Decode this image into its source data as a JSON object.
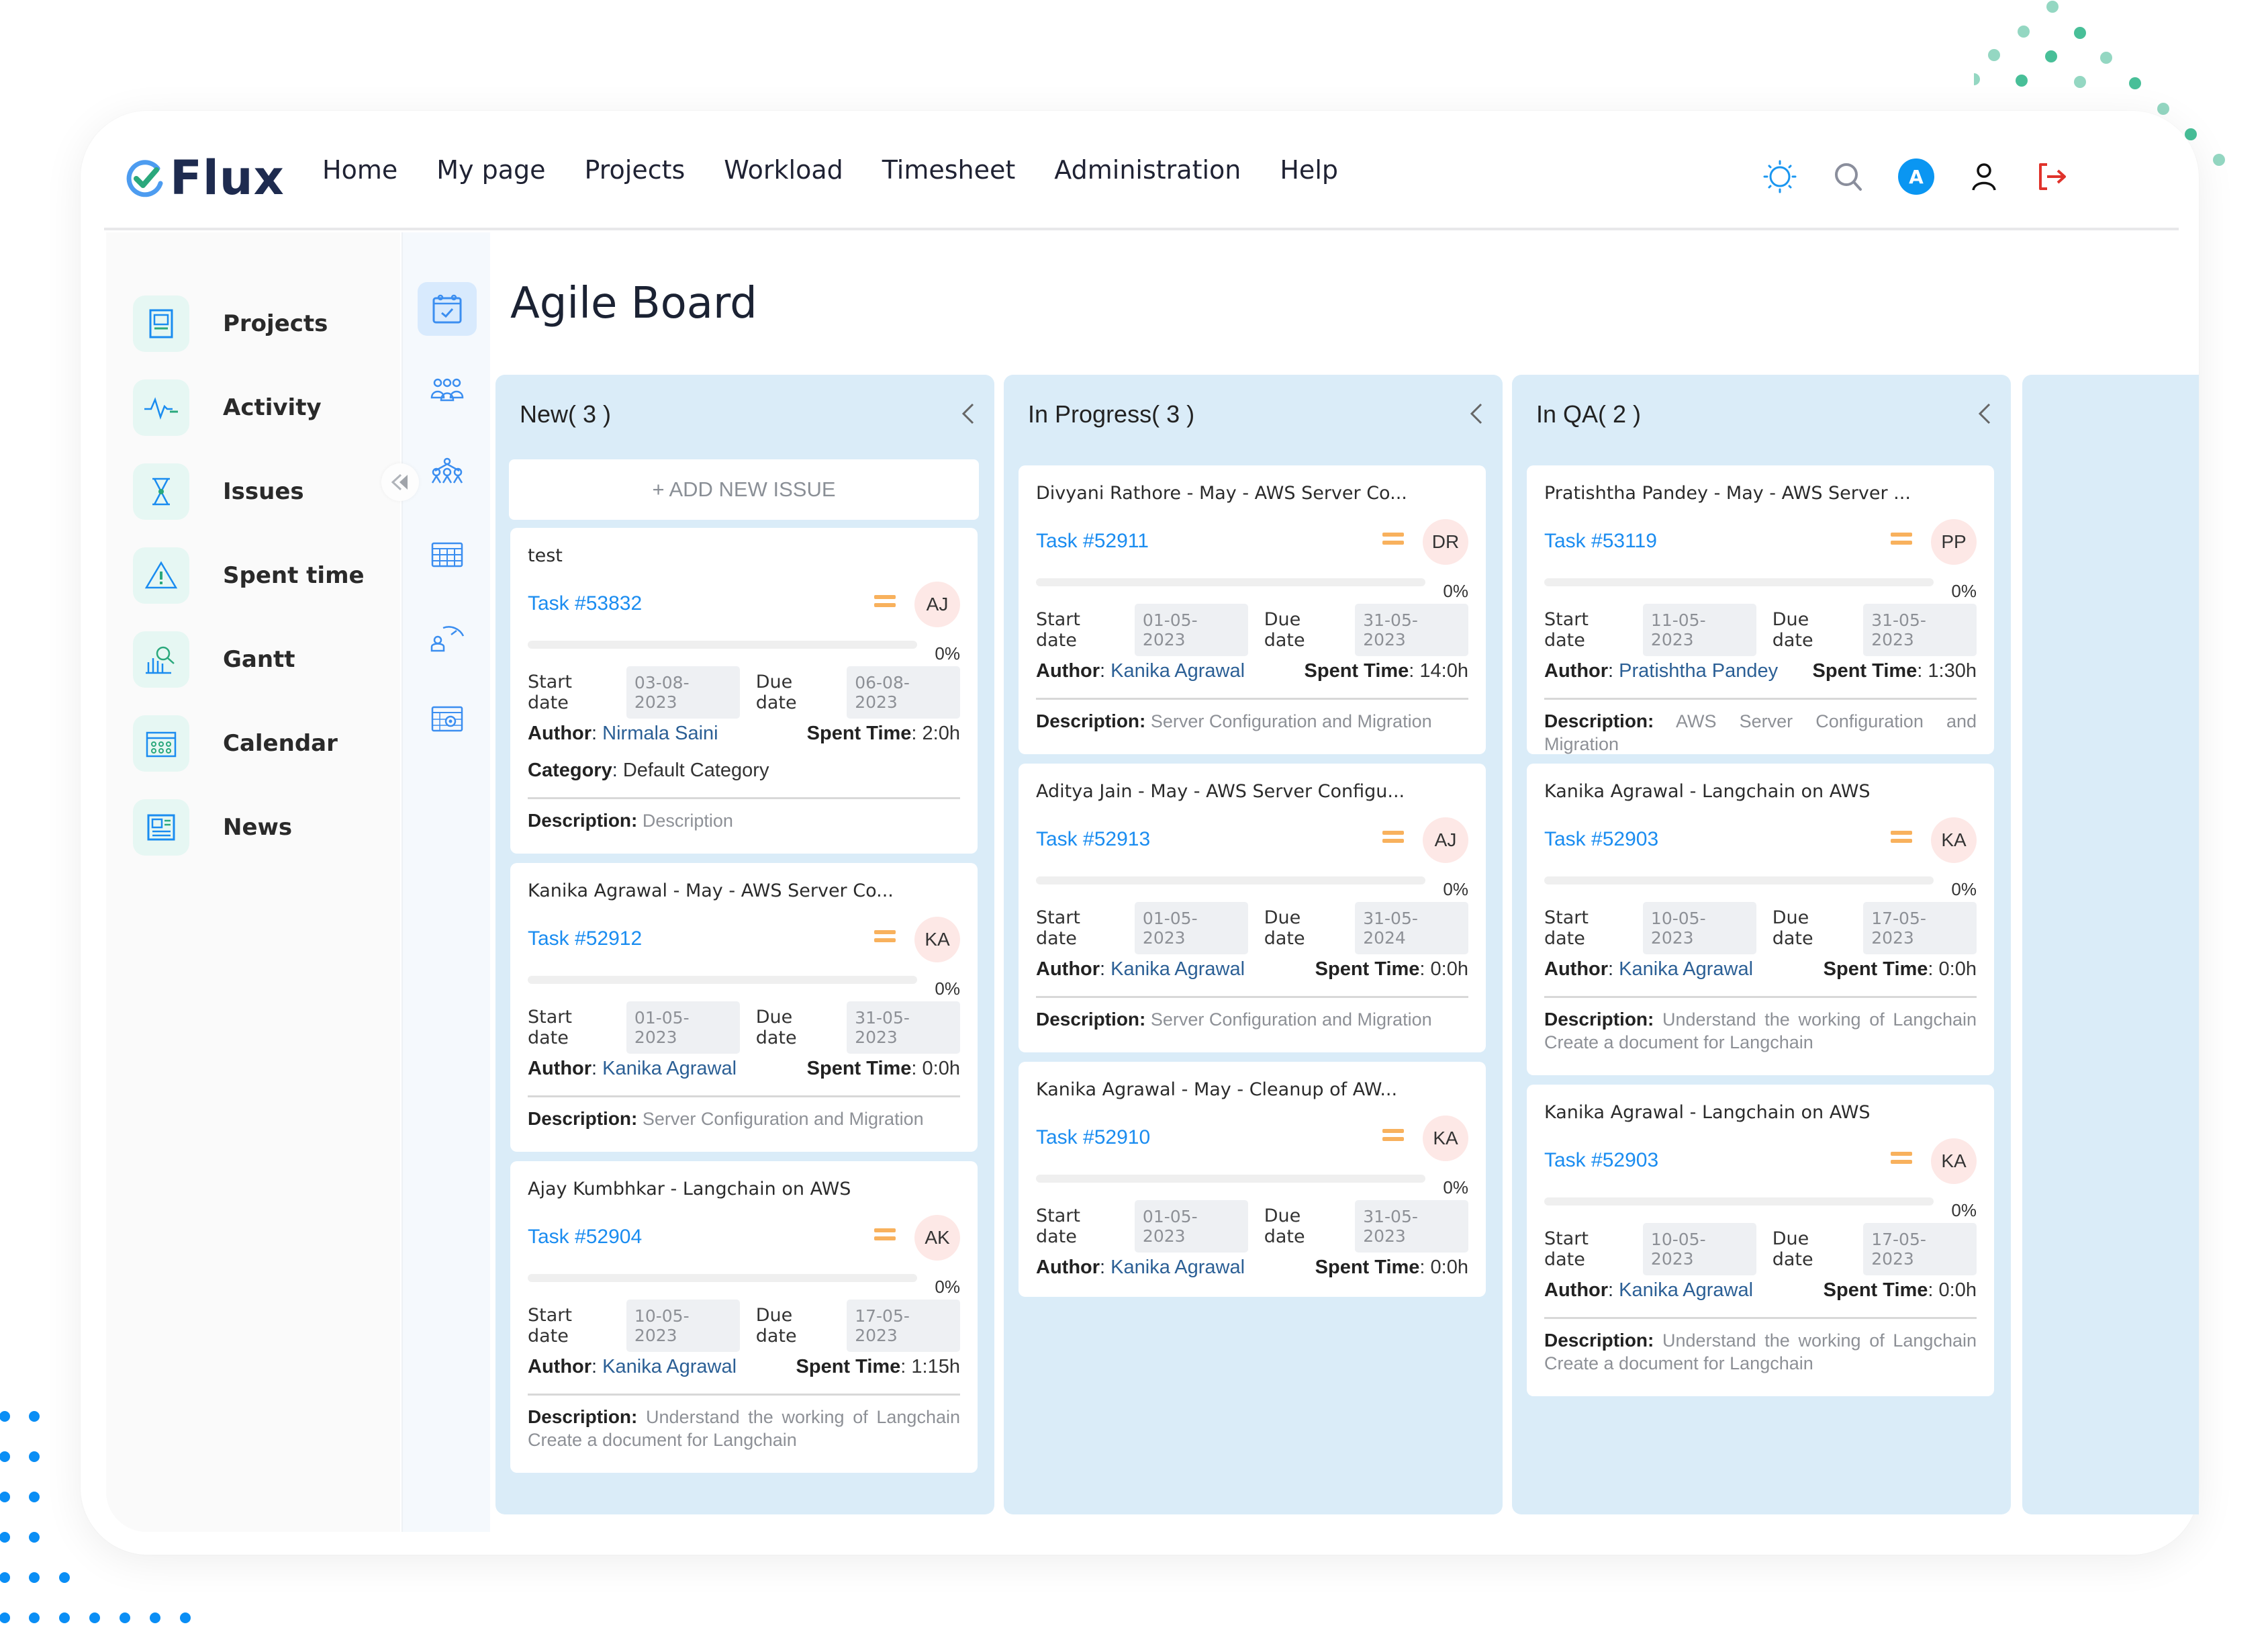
{
  "app": {
    "name": "Flux"
  },
  "nav": [
    "Home",
    "My page",
    "Projects",
    "Workload",
    "Timesheet",
    "Administration",
    "Help"
  ],
  "header_icons": {
    "theme": "sun-icon",
    "search": "search-icon",
    "avatar_initial": "A",
    "profile": "user-icon",
    "logout": "logout-icon"
  },
  "sidebar": {
    "items": [
      {
        "label": "Projects",
        "icon": "project-board-icon"
      },
      {
        "label": "Activity",
        "icon": "activity-pulse-icon"
      },
      {
        "label": "Issues",
        "icon": "hourglass-icon"
      },
      {
        "label": "Spent time",
        "icon": "warning-triangle-icon"
      },
      {
        "label": "Gantt",
        "icon": "gantt-chart-icon"
      },
      {
        "label": "Calendar",
        "icon": "calendar-icon"
      },
      {
        "label": "News",
        "icon": "news-icon"
      }
    ]
  },
  "rail": [
    "agile-board-icon",
    "team-icon",
    "network-icon",
    "table-icon",
    "performance-icon",
    "calendar-settings-icon"
  ],
  "page": {
    "title": "Agile Board"
  },
  "labels": {
    "add_issue": "+ ADD NEW ISSUE",
    "start_date": "Start date",
    "due_date": "Due date",
    "author": "Author",
    "spent_time": "Spent Time",
    "category": "Category",
    "description": "Description:"
  },
  "columns": [
    {
      "title": "New( 3 )",
      "cards": [
        {
          "title": "test",
          "task": "Task #53832",
          "assignee": "AJ",
          "progress": 0,
          "progress_label": "0%",
          "start": "03-08-2023",
          "due": "06-08-2023",
          "author": "Nirmala Saini",
          "spent": "2:0h",
          "category": "Default Category",
          "description": "Description"
        },
        {
          "title": "Kanika Agrawal - May - AWS Server Co...",
          "task": "Task #52912",
          "assignee": "KA",
          "progress": 0,
          "progress_label": "0%",
          "start": "01-05-2023",
          "due": "31-05-2023",
          "author": "Kanika Agrawal",
          "spent": "0:0h",
          "description": "Server Configuration and Migration"
        },
        {
          "title": "Ajay Kumbhkar - Langchain on AWS",
          "task": "Task #52904",
          "assignee": "AK",
          "progress": 0,
          "progress_label": "0%",
          "start": "10-05-2023",
          "due": "17-05-2023",
          "author": "Kanika Agrawal",
          "spent": "1:15h",
          "description": "Understand the working of Langchain Create a document for Langchain"
        }
      ]
    },
    {
      "title": "In Progress( 3 )",
      "cards": [
        {
          "title": "Divyani Rathore - May - AWS Server Co...",
          "task": "Task #52911",
          "assignee": "DR",
          "progress": 0,
          "progress_label": "0%",
          "start": "01-05-2023",
          "due": "31-05-2023",
          "author": "Kanika Agrawal",
          "spent": "14:0h",
          "description": "Server Configuration and Migration"
        },
        {
          "title": "Aditya Jain - May - AWS Server Configu...",
          "task": "Task #52913",
          "assignee": "AJ",
          "progress": 0,
          "progress_label": "0%",
          "start": "01-05-2023",
          "due": "31-05-2024",
          "author": "Kanika Agrawal",
          "spent": "0:0h",
          "description": "Server Configuration and Migration"
        },
        {
          "title": "Kanika Agrawal - May - Cleanup of AW...",
          "task": "Task #52910",
          "assignee": "KA",
          "progress": 0,
          "progress_label": "0%",
          "start": "01-05-2023",
          "due": "31-05-2023",
          "author": "Kanika Agrawal",
          "spent": "0:0h"
        }
      ]
    },
    {
      "title": "In QA( 2 )",
      "cards": [
        {
          "title": "Pratishtha Pandey - May - AWS Server ...",
          "task": "Task #53119",
          "assignee": "PP",
          "progress": 0,
          "progress_label": "0%",
          "start": "11-05-2023",
          "due": "31-05-2023",
          "author": "Pratishtha Pandey",
          "spent": "1:30h",
          "description": "AWS Server Configuration and Migration"
        },
        {
          "title": "Kanika Agrawal - Langchain on AWS",
          "task": "Task #52903",
          "assignee": "KA",
          "progress": 0,
          "progress_label": "0%",
          "start": "10-05-2023",
          "due": "17-05-2023",
          "author": "Kanika Agrawal",
          "spent": "0:0h",
          "description": "Understand the working of Langchain Create a document for Langchain"
        },
        {
          "title": "Kanika Agrawal - Langchain on AWS",
          "task": "Task #52903",
          "assignee": "KA",
          "progress": 0,
          "progress_label": "0%",
          "start": "10-05-2023",
          "due": "17-05-2023",
          "author": "Kanika Agrawal",
          "spent": "0:0h",
          "description": "Understand the working of Langchain Create a document for Langchain"
        }
      ]
    }
  ],
  "colors": {
    "accent": "#1a8cf0",
    "column_bg": "#daecf8",
    "priority": "#f8b15d",
    "assignee_bg": "#fde8e6",
    "logout": "#e0332b",
    "brand_dark": "#1e2b4f"
  }
}
